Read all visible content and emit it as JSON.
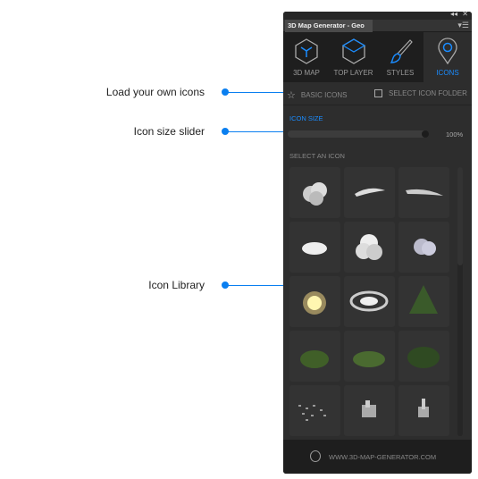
{
  "annotations": [
    {
      "label": "Load your own icons"
    },
    {
      "label": "Icon size slider"
    },
    {
      "label": "Icon Library"
    }
  ],
  "panel": {
    "title": "3D Map Generator - Geo",
    "tabs": [
      {
        "label": "3D MAP",
        "icon": "hexagon-cube-icon"
      },
      {
        "label": "TOP LAYER",
        "icon": "hexagon-top-icon"
      },
      {
        "label": "STYLES",
        "icon": "brush-icon"
      },
      {
        "label": "ICONS",
        "icon": "map-pin-icon",
        "active": true
      }
    ],
    "basic_icons": "BASIC ICONS",
    "select_folder": "SELECT ICON FOLDER",
    "icon_size_label": "ICON SIZE",
    "icon_size_value": "100%",
    "icon_size_percent": 100,
    "select_icon_label": "SELECT AN ICON",
    "icons": [
      "cloud-cluster",
      "wind-streak",
      "wind-streak-wide",
      "small-cloud",
      "big-cloud",
      "storm-cloud",
      "sun",
      "hurricane",
      "forest-tall",
      "forest-small",
      "forest-patch",
      "forest-dense",
      "village-scatter",
      "city-block",
      "city-tower"
    ],
    "footer": "WWW.3D-MAP-GENERATOR.COM"
  },
  "colors": {
    "accent": "#1a8cff",
    "panel": "#2d2d2d"
  }
}
